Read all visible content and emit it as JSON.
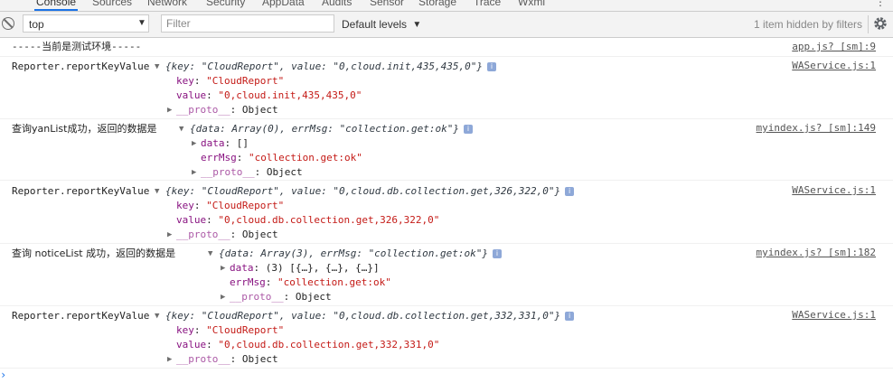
{
  "tabs": [
    "Console",
    "Sources",
    "Network",
    "Security",
    "AppData",
    "Audits",
    "Sensor",
    "Storage",
    "Trace",
    "Wxml"
  ],
  "toolbar": {
    "context_value": "top",
    "filter_placeholder": "Filter",
    "levels_label": "Default levels",
    "hidden_info": "1 item hidden by filters"
  },
  "messages": [
    {
      "text": "-----当前是测试环境-----",
      "source": "app.js? [sm]:9"
    },
    {
      "prefix": "Reporter.reportKeyValue",
      "summary": "{key: \"CloudReport\", value: \"0,cloud.init,435,435,0\"}",
      "props": [
        {
          "key": "key",
          "value": "\"CloudReport\""
        },
        {
          "key": "value",
          "value": "\"0,cloud.init,435,435,0\""
        }
      ],
      "proto": "__proto__",
      "proto_value": "Object",
      "source": "WAService.js:1"
    },
    {
      "prefix": "查询yanList成功，返回的数据是",
      "summary": "{data: Array(0), errMsg: \"collection.get:ok\"}",
      "props": [
        {
          "key": "data",
          "value": "[]"
        },
        {
          "key": "errMsg",
          "value": "\"collection.get:ok\""
        }
      ],
      "proto": "__proto__",
      "proto_value": "Object",
      "source": "myindex.js? [sm]:149"
    },
    {
      "prefix": "Reporter.reportKeyValue",
      "summary": "{key: \"CloudReport\", value: \"0,cloud.db.collection.get,326,322,0\"}",
      "props": [
        {
          "key": "key",
          "value": "\"CloudReport\""
        },
        {
          "key": "value",
          "value": "\"0,cloud.db.collection.get,326,322,0\""
        }
      ],
      "proto": "__proto__",
      "proto_value": "Object",
      "source": "WAService.js:1"
    },
    {
      "prefix": "查询 noticeList 成功，返回的数据是",
      "summary": "{data: Array(3), errMsg: \"collection.get:ok\"}",
      "props": [
        {
          "key": "data",
          "value": "(3) [{…}, {…}, {…}]"
        },
        {
          "key": "errMsg",
          "value": "\"collection.get:ok\""
        }
      ],
      "proto": "__proto__",
      "proto_value": "Object",
      "source": "myindex.js? [sm]:182"
    },
    {
      "prefix": "Reporter.reportKeyValue",
      "summary": "{key: \"CloudReport\", value: \"0,cloud.db.collection.get,332,331,0\"}",
      "props": [
        {
          "key": "key",
          "value": "\"CloudReport\""
        },
        {
          "key": "value",
          "value": "\"0,cloud.db.collection.get,332,331,0\""
        }
      ],
      "proto": "__proto__",
      "proto_value": "Object",
      "source": "WAService.js:1"
    }
  ],
  "icons": {
    "clear": "clear-console-icon",
    "eye": "eye-icon",
    "gear": "gear-icon",
    "expand": "triangle-right-icon",
    "collapse": "triangle-down-icon",
    "info": "info-icon"
  },
  "colors": {
    "string": "#c41a16",
    "property": "#881280",
    "link": "#545454",
    "accent": "#1a73e8"
  }
}
